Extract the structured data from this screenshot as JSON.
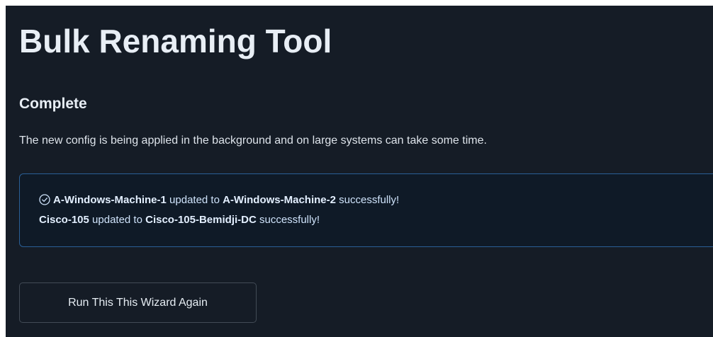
{
  "page": {
    "title": "Bulk Renaming Tool"
  },
  "status": {
    "heading": "Complete",
    "description": "The new config is being applied in the background and on large systems can take some time."
  },
  "results": {
    "icon": "check-circle-icon",
    "items": [
      {
        "old_name": "A-Windows-Machine-1",
        "connector": " updated to ",
        "new_name": "A-Windows-Machine-2",
        "suffix": " successfully!"
      },
      {
        "old_name": "Cisco-105",
        "connector": " updated to ",
        "new_name": "Cisco-105-Bemidji-DC",
        "suffix": " successfully!"
      }
    ]
  },
  "actions": {
    "run_again_label": "Run This This Wizard Again"
  },
  "colors": {
    "background": "#151c26",
    "alert_border": "#2a5f96",
    "alert_text": "#cfe3fb"
  }
}
